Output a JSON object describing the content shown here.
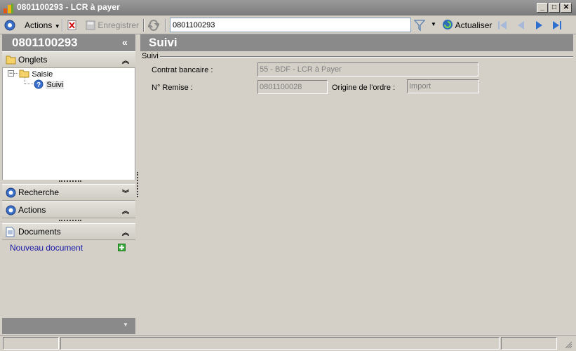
{
  "window": {
    "title": "0801100293 -  LCR à payer",
    "minimize": "_",
    "maximize": "□",
    "close": "✕"
  },
  "toolbar": {
    "actions_label": "Actions",
    "save_label": "Enregistrer",
    "search_value": "0801100293",
    "refresh_label": "Actualiser"
  },
  "left": {
    "record_number": "0801100293",
    "collapse_glyph": "«",
    "tabs_header": "Onglets",
    "tree": {
      "root": "Saisie",
      "child": "Suivi"
    },
    "search_header": "Recherche",
    "actions_header": "Actions",
    "documents_header": "Documents",
    "new_document": "Nouveau document"
  },
  "content": {
    "title": "Suivi",
    "group_legend": "Suivi",
    "contract_label": "Contrat bancaire :",
    "contract_value": "55 - BDF - LCR à Payer",
    "remise_label": "N° Remise :",
    "remise_value": "0801100028",
    "origin_label": "Origine de l'ordre :",
    "origin_value": "Import"
  },
  "colors": {
    "header_gray": "#8a8a8a",
    "link_blue": "#1a1aa6",
    "panel_bg": "#d4d0c8"
  }
}
